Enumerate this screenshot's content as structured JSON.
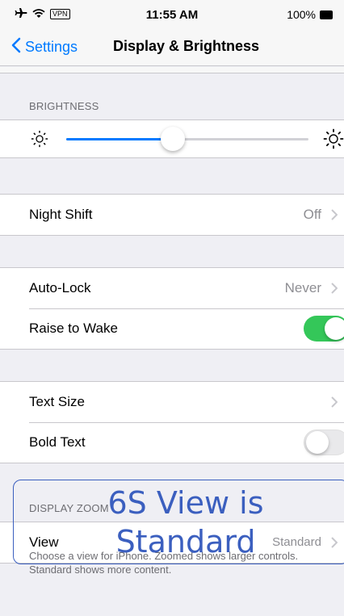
{
  "status_bar": {
    "vpn": "VPN",
    "time": "11:55 AM",
    "battery": "100%"
  },
  "nav": {
    "back_label": "Settings",
    "title": "Display & Brightness"
  },
  "brightness": {
    "header": "BRIGHTNESS",
    "level": 0.44
  },
  "rows": {
    "night_shift": {
      "label": "Night Shift",
      "value": "Off"
    },
    "auto_lock": {
      "label": "Auto-Lock",
      "value": "Never"
    },
    "raise_to_wake": {
      "label": "Raise to Wake",
      "on": true
    },
    "text_size": {
      "label": "Text Size"
    },
    "bold_text": {
      "label": "Bold Text",
      "on": false
    }
  },
  "display_zoom": {
    "header": "DISPLAY ZOOM",
    "view_label": "View",
    "view_value": "Standard",
    "footer": "Choose a view for iPhone. Zoomed shows larger controls. Standard shows more content."
  },
  "annotation": {
    "text": "6S View is Standard"
  },
  "colors": {
    "accent": "#007aff",
    "toggle_on": "#34c759",
    "annotation": "#3b5fbf"
  }
}
